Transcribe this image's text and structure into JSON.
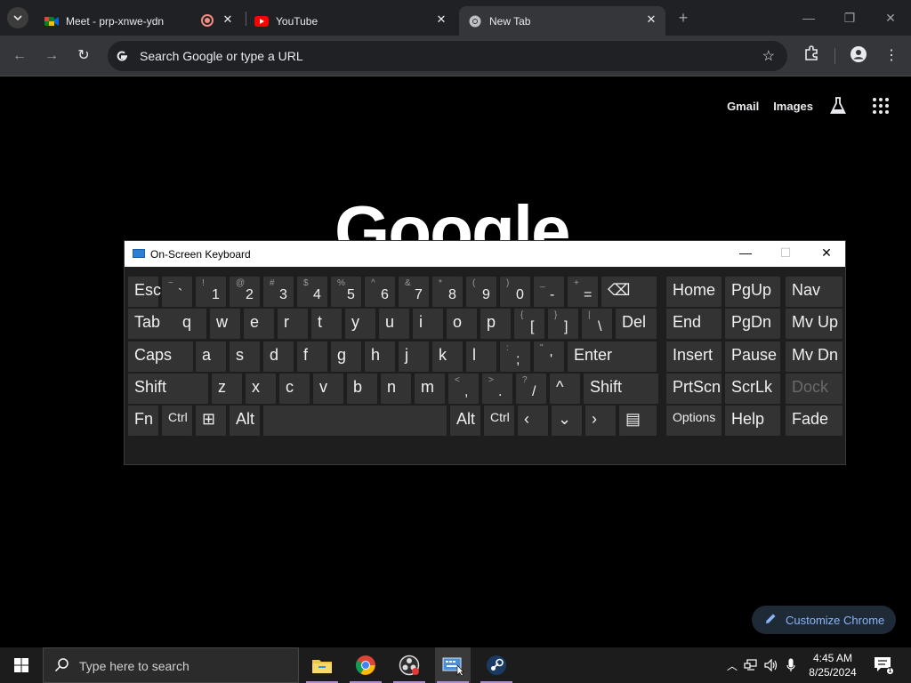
{
  "browser": {
    "tabs": [
      {
        "title": "Meet - prp-xnwe-ydn",
        "favicon": "google-meet-icon",
        "has_recording": true
      },
      {
        "title": "YouTube",
        "favicon": "youtube-icon"
      },
      {
        "title": "New Tab",
        "favicon": "chrome-icon",
        "active": true
      }
    ],
    "omnibox_placeholder": "Search Google or type a URL"
  },
  "newtab": {
    "links": [
      "Gmail",
      "Images"
    ],
    "logo_text": "Google",
    "customize_label": "Customize Chrome"
  },
  "osk": {
    "title": "On-Screen Keyboard",
    "rows": [
      [
        {
          "l": "Esc"
        },
        {
          "s": "~",
          "m": "`"
        },
        {
          "s": "!",
          "m": "1"
        },
        {
          "s": "@",
          "m": "2"
        },
        {
          "s": "#",
          "m": "3"
        },
        {
          "s": "$",
          "m": "4"
        },
        {
          "s": "%",
          "m": "5"
        },
        {
          "s": "^",
          "m": "6"
        },
        {
          "s": "&",
          "m": "7"
        },
        {
          "s": "*",
          "m": "8"
        },
        {
          "s": "(",
          "m": "9"
        },
        {
          "s": ")",
          "m": "0"
        },
        {
          "s": "_",
          "m": "-"
        },
        {
          "s": "+",
          "m": "="
        },
        {
          "l": "⌫"
        },
        {
          "l": "Home"
        },
        {
          "l": "PgUp"
        },
        {
          "l": "Nav"
        }
      ],
      [
        {
          "l": "Tab"
        },
        {
          "l": "q"
        },
        {
          "l": "w"
        },
        {
          "l": "e"
        },
        {
          "l": "r"
        },
        {
          "l": "t"
        },
        {
          "l": "y"
        },
        {
          "l": "u"
        },
        {
          "l": "i"
        },
        {
          "l": "o"
        },
        {
          "l": "p"
        },
        {
          "s": "{",
          "m": "["
        },
        {
          "s": "}",
          "m": "]"
        },
        {
          "s": "|",
          "m": "\\"
        },
        {
          "l": "Del"
        },
        {
          "l": "End"
        },
        {
          "l": "PgDn"
        },
        {
          "l": "Mv Up"
        }
      ],
      [
        {
          "l": "Caps"
        },
        {
          "l": "a"
        },
        {
          "l": "s"
        },
        {
          "l": "d"
        },
        {
          "l": "f"
        },
        {
          "l": "g"
        },
        {
          "l": "h"
        },
        {
          "l": "j"
        },
        {
          "l": "k"
        },
        {
          "l": "l"
        },
        {
          "s": ":",
          "m": ";"
        },
        {
          "s": "\"",
          "m": "'"
        },
        {
          "l": "Enter"
        },
        {
          "l": "Insert"
        },
        {
          "l": "Pause"
        },
        {
          "l": "Mv Dn"
        }
      ],
      [
        {
          "l": "Shift"
        },
        {
          "l": "z"
        },
        {
          "l": "x"
        },
        {
          "l": "c"
        },
        {
          "l": "v"
        },
        {
          "l": "b"
        },
        {
          "l": "n"
        },
        {
          "l": "m"
        },
        {
          "s": "<",
          "m": ","
        },
        {
          "s": ">",
          "m": "."
        },
        {
          "s": "?",
          "m": "/"
        },
        {
          "l": "^"
        },
        {
          "l": "Shift"
        },
        {
          "l": "PrtScn"
        },
        {
          "l": "ScrLk"
        },
        {
          "l": "Dock"
        }
      ],
      [
        {
          "l": "Fn"
        },
        {
          "l": "Ctrl"
        },
        {
          "l": "⊞"
        },
        {
          "l": "Alt"
        },
        {
          "l": ""
        },
        {
          "l": "Alt"
        },
        {
          "l": "Ctrl"
        },
        {
          "l": "‹"
        },
        {
          "l": "⌄"
        },
        {
          "l": "›"
        },
        {
          "l": "▤"
        },
        {
          "l": "Options"
        },
        {
          "l": "Help"
        },
        {
          "l": "Fade"
        }
      ]
    ]
  },
  "taskbar": {
    "search_placeholder": "Type here to search",
    "apps": [
      "file-explorer-icon",
      "chrome-icon",
      "obs-icon",
      "on-screen-keyboard-icon",
      "steam-icon"
    ],
    "time": "4:45 AM",
    "date": "8/25/2024"
  }
}
